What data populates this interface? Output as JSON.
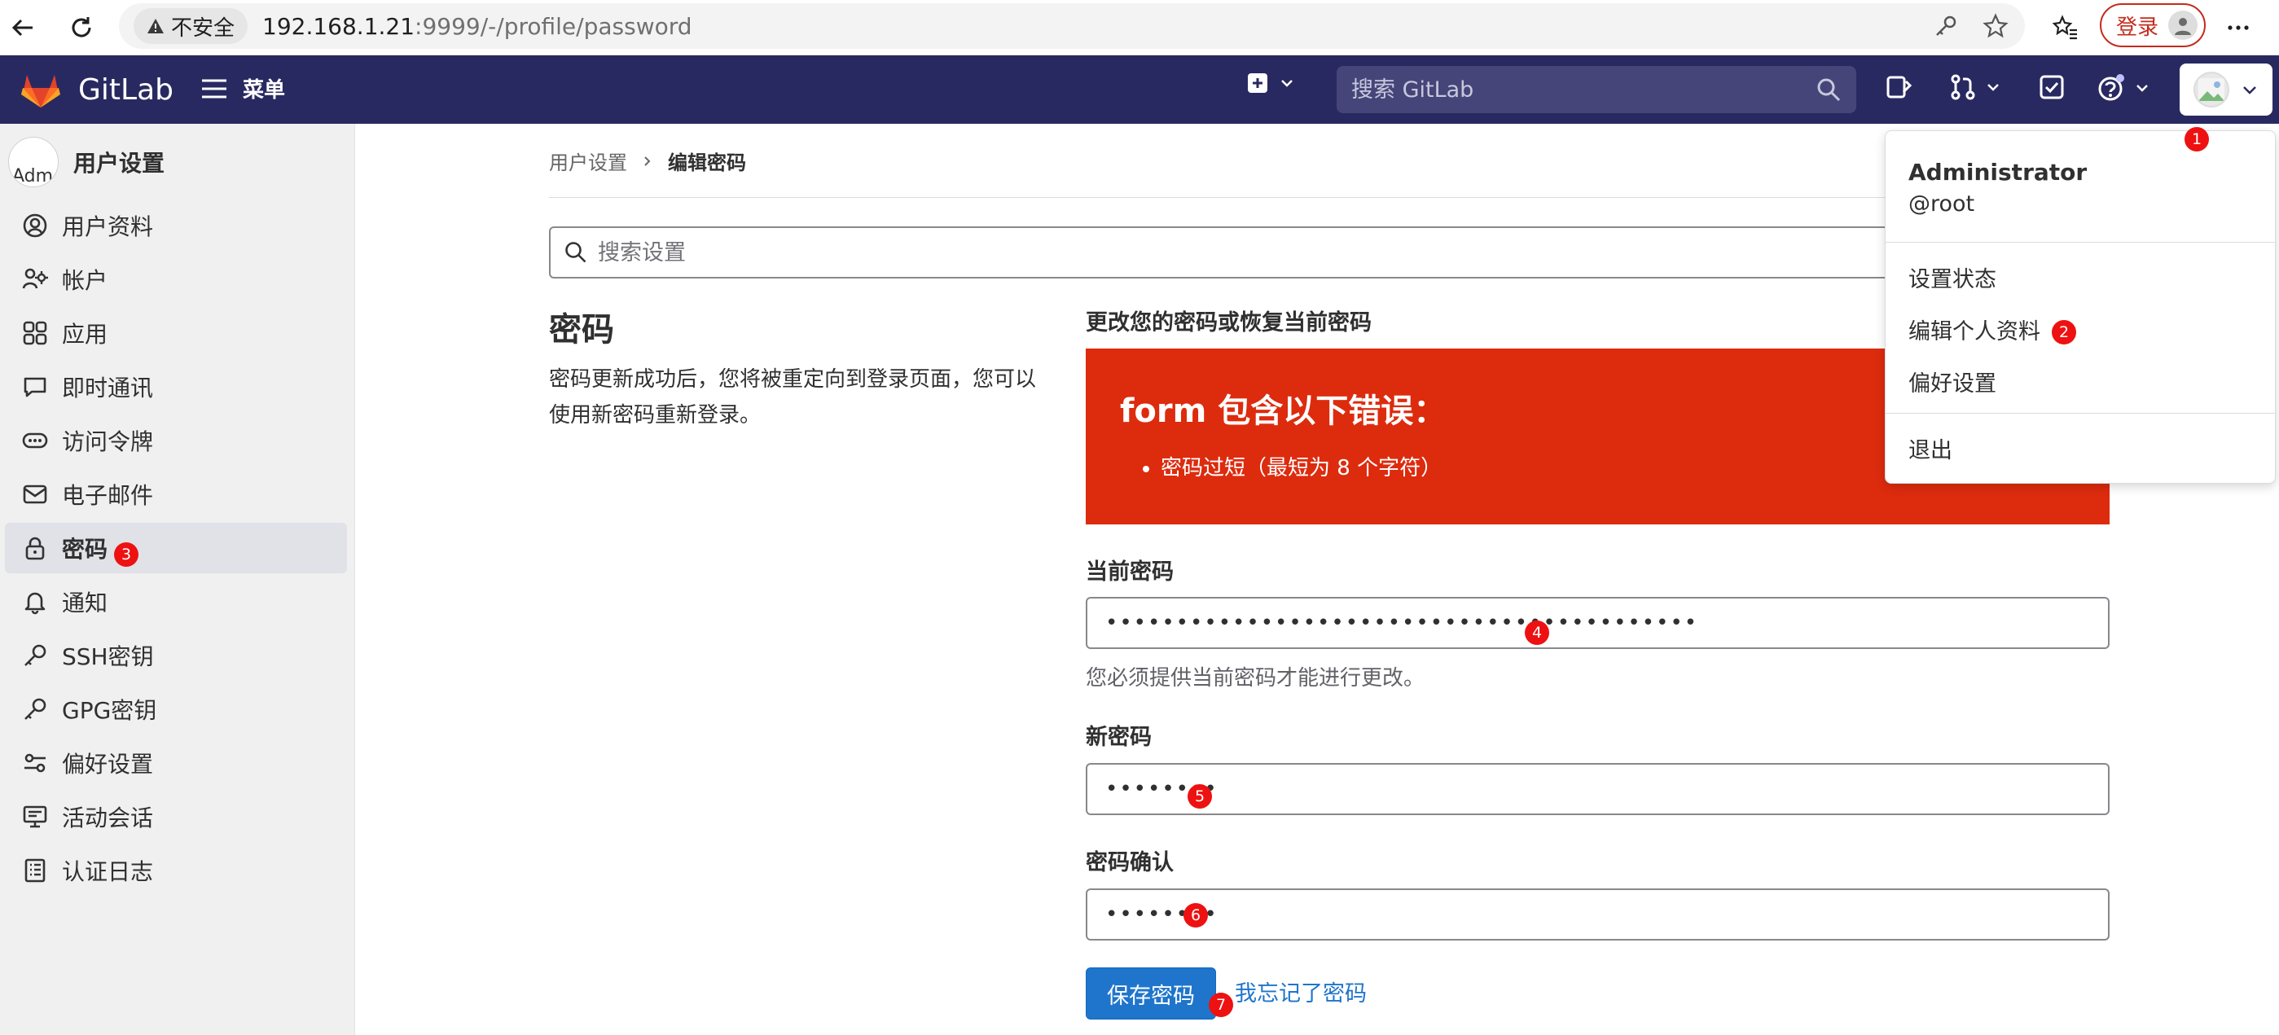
{
  "browser": {
    "security_label": "不安全",
    "url_host": "192.168.1.21",
    "url_rest": ":9999/-/profile/password",
    "login_label": "登录"
  },
  "header": {
    "brand": "GitLab",
    "menu_label": "菜单",
    "search_placeholder": "搜索 GitLab",
    "brand_color": "#292961"
  },
  "sidebar": {
    "title": "用户设置",
    "avatar_alt": "Adm",
    "items": [
      {
        "label": "用户资料",
        "icon": "user-icon"
      },
      {
        "label": "帐户",
        "icon": "account-icon"
      },
      {
        "label": "应用",
        "icon": "applications-icon"
      },
      {
        "label": "即时通讯",
        "icon": "chat-icon"
      },
      {
        "label": "访问令牌",
        "icon": "token-icon"
      },
      {
        "label": "电子邮件",
        "icon": "mail-icon"
      },
      {
        "label": "密码",
        "icon": "lock-icon"
      },
      {
        "label": "通知",
        "icon": "bell-icon"
      },
      {
        "label": "SSH密钥",
        "icon": "key-icon"
      },
      {
        "label": "GPG密钥",
        "icon": "key-icon"
      },
      {
        "label": "偏好设置",
        "icon": "preferences-icon"
      },
      {
        "label": "活动会话",
        "icon": "monitor-icon"
      },
      {
        "label": "认证日志",
        "icon": "log-icon"
      }
    ],
    "active_index": 6
  },
  "breadcrumb": {
    "parent": "用户设置",
    "current": "编辑密码"
  },
  "settings_search": {
    "placeholder": "搜索设置"
  },
  "section": {
    "title": "密码",
    "description": "密码更新成功后，您将被重定向到登录页面，您可以使用新密码重新登录。"
  },
  "form": {
    "heading": "更改您的密码或恢复当前密码",
    "error_title": "form 包含以下错误：",
    "errors": [
      "密码过短（最短为 8 个字符）"
    ],
    "current_password_label": "当前密码",
    "current_password_value": "••••••••••••••••••••••••••••••••••••••••••",
    "current_password_help": "您必须提供当前密码才能进行更改。",
    "new_password_label": "新密码",
    "new_password_value": "••••••••",
    "confirm_password_label": "密码确认",
    "confirm_password_value": "••••••••",
    "save_label": "保存密码",
    "forgot_label": "我忘记了密码",
    "error_color": "#dd2b0e",
    "primary_color": "#1f75cb"
  },
  "user_dropdown": {
    "name": "Administrator",
    "handle": "@root",
    "items": [
      "设置状态",
      "编辑个人资料",
      "偏好设置"
    ],
    "signout": "退出"
  },
  "markers": [
    "1",
    "2",
    "3",
    "4",
    "5",
    "6",
    "7"
  ]
}
